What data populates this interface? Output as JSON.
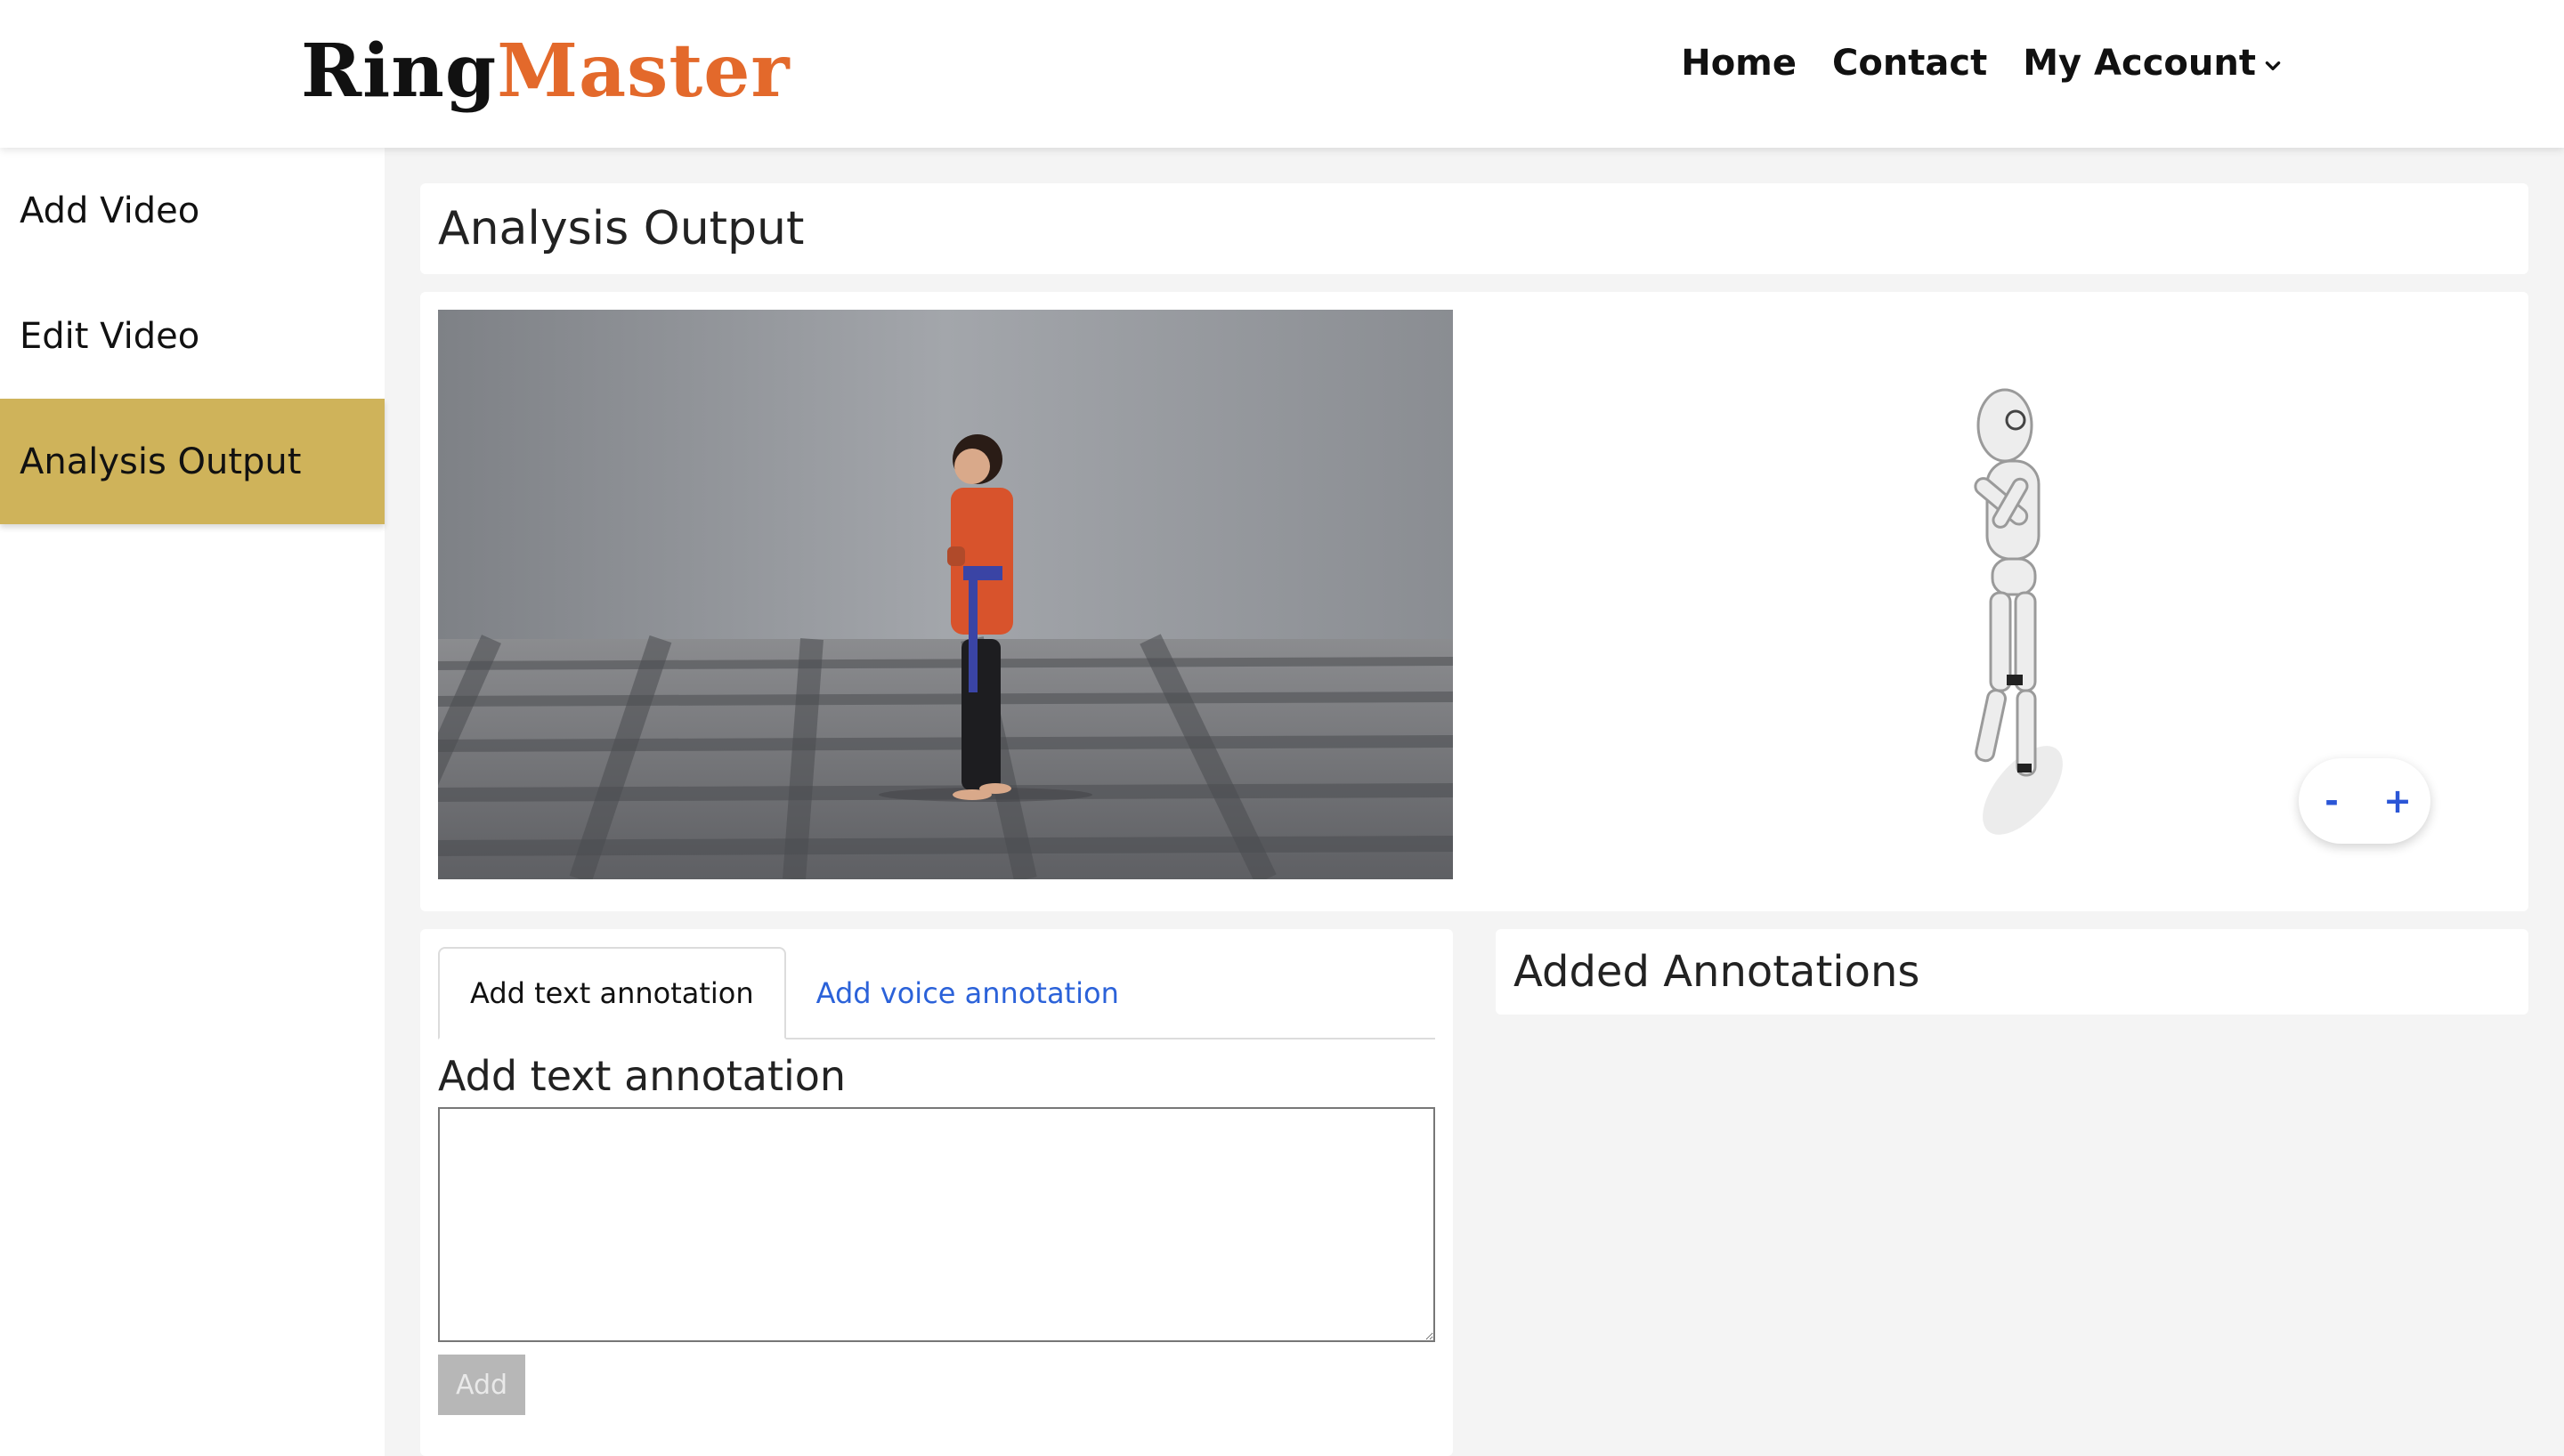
{
  "header": {
    "logo_part1": "Ring",
    "logo_part2": "Master",
    "nav": {
      "home": "Home",
      "contact": "Contact",
      "account": "My Account"
    }
  },
  "sidebar": {
    "items": [
      {
        "label": "Add Video"
      },
      {
        "label": "Edit Video"
      },
      {
        "label": "Analysis Output"
      }
    ],
    "active_index": 2
  },
  "main": {
    "title": "Analysis Output",
    "viewer": {
      "zoom_out": "-",
      "zoom_in": "+"
    },
    "annotation": {
      "tabs": [
        "Add text annotation",
        "Add voice annotation"
      ],
      "form_title": "Add text annotation",
      "textarea_value": "",
      "add_button": "Add"
    },
    "added_annotations_title": "Added Annotations"
  },
  "colors": {
    "accent_logo": "#e3692b",
    "active_sidebar": "#cfb35a",
    "link": "#2b62d9"
  }
}
